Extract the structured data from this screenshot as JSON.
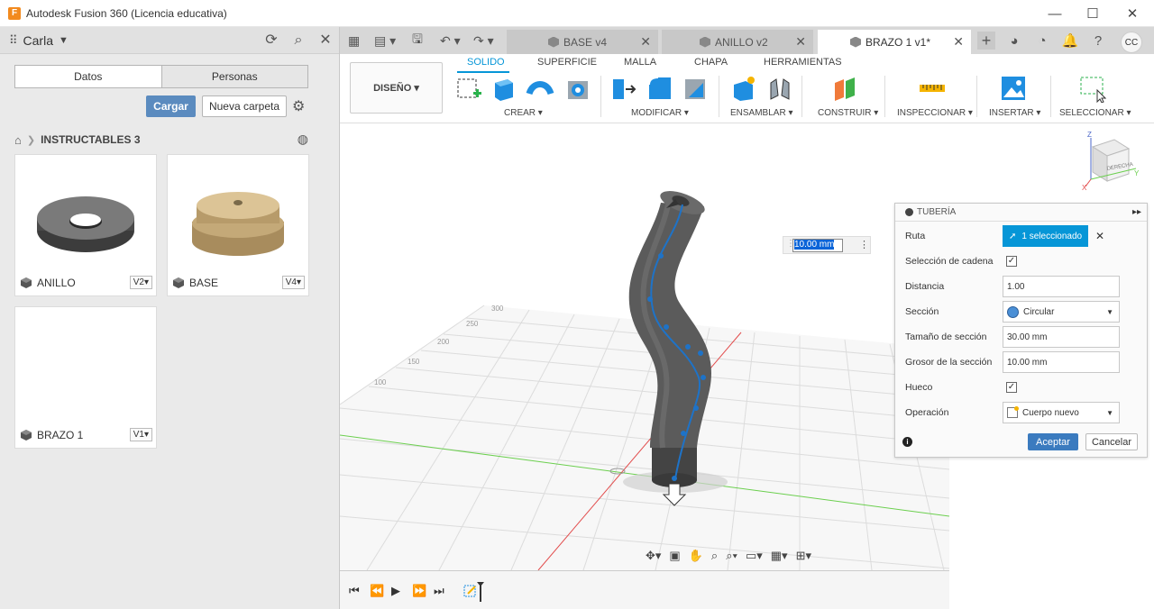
{
  "window": {
    "title": "Autodesk Fusion 360 (Licencia educativa)",
    "logo_letter": "F",
    "minimize": "—",
    "maximize": "☐",
    "close": "✕"
  },
  "data_panel": {
    "user": "Carla",
    "tabs": [
      "Datos",
      "Personas"
    ],
    "upload_label": "Cargar",
    "new_folder_label": "Nueva carpeta",
    "folder": "INSTRUCTABLES 3",
    "files": [
      {
        "name": "ANILLO",
        "version": "V2▾"
      },
      {
        "name": "BASE",
        "version": "V4▾"
      },
      {
        "name": "BRAZO 1",
        "version": "V1▾"
      }
    ]
  },
  "doc_tabs": [
    {
      "label": "BASE v4",
      "active": false
    },
    {
      "label": "ANILLO v2",
      "active": false
    },
    {
      "label": "BRAZO 1 v1*",
      "active": true
    }
  ],
  "user_initials": "CC",
  "ribbon": {
    "workspace": "DISEÑO ▾",
    "tabs": [
      "SOLIDO",
      "SUPERFICIE",
      "MALLA",
      "CHAPA",
      "HERRAMIENTAS"
    ],
    "groups": [
      "CREAR ▾",
      "MODIFICAR ▾",
      "ENSAMBLAR ▾",
      "CONSTRUIR ▾",
      "INSPECCIONAR ▾",
      "INSERTAR ▾",
      "SELECCIONAR ▾"
    ]
  },
  "viewcube_label": "DERECHA",
  "grid_labels": [
    "300",
    "250",
    "200",
    "150",
    "100"
  ],
  "dimension_value": "10.00 mm",
  "dialog": {
    "title": "TUBERÍA",
    "rows": {
      "ruta": "Ruta",
      "ruta_value": "1 seleccionado",
      "cadena": "Selección de cadena",
      "distancia": "Distancia",
      "distancia_value": "1.00",
      "seccion": "Sección",
      "seccion_value": "Circular",
      "tamano": "Tamaño de sección",
      "tamano_value": "30.00 mm",
      "grosor": "Grosor de la sección",
      "grosor_value": "10.00 mm",
      "hueco": "Hueco",
      "operacion": "Operación",
      "operacion_value": "Cuerpo nuevo"
    },
    "ok": "Aceptar",
    "cancel": "Cancelar"
  },
  "colors": {
    "accent": "#0696d7",
    "upload_button": "#5b8bbf",
    "ok_button": "#3b7bbf",
    "x_axis": "#e24b4b",
    "y_axis": "#6bcf4e"
  }
}
